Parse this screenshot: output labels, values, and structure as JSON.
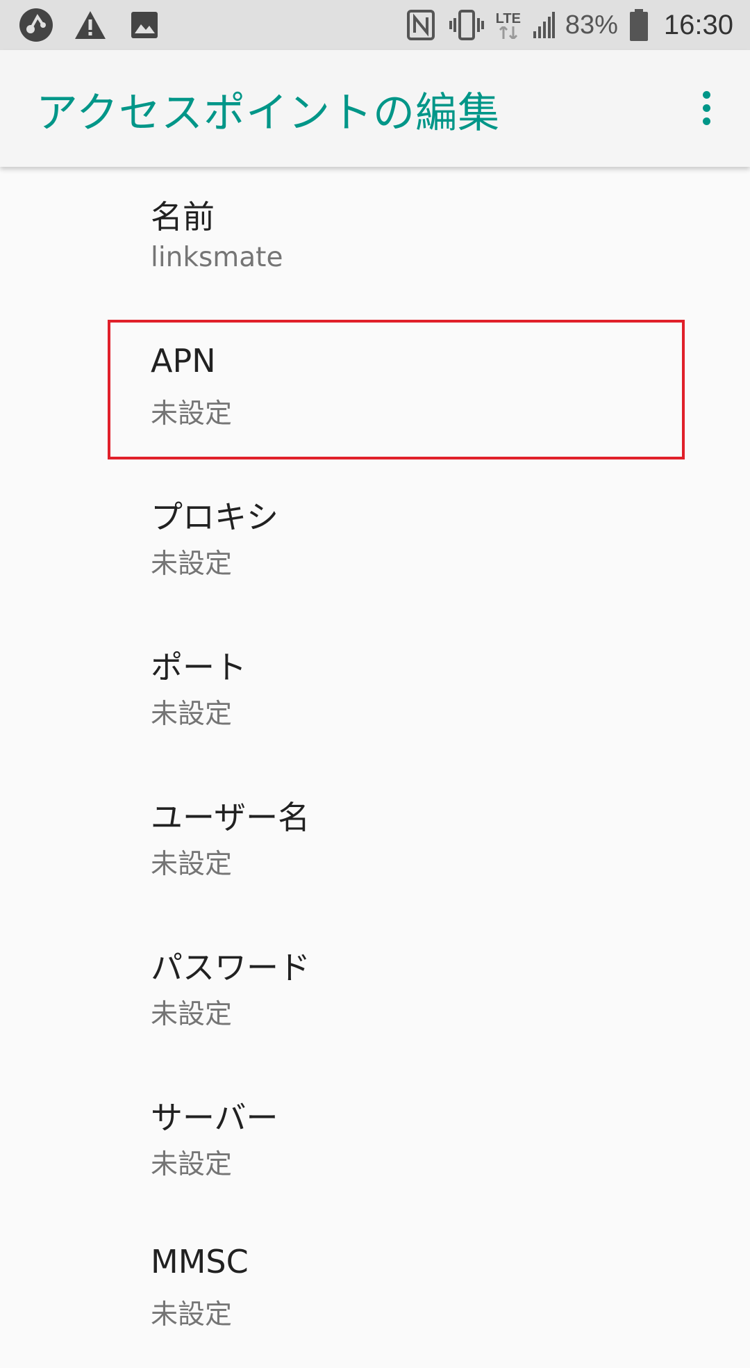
{
  "status_bar": {
    "battery_percent": "83%",
    "time": "16:30",
    "network_type": "LTE",
    "icons": [
      "app-notification-icon",
      "warning-icon",
      "image-icon",
      "nfc-icon",
      "vibrate-icon",
      "lte-icon",
      "signal-icon",
      "battery-icon"
    ]
  },
  "app_bar": {
    "title": "アクセスポイントの編集",
    "accent_color": "#009688"
  },
  "settings": [
    {
      "title": "名前",
      "value": "linksmate"
    },
    {
      "title": "APN",
      "value": "未設定"
    },
    {
      "title": "プロキシ",
      "value": "未設定"
    },
    {
      "title": "ポート",
      "value": "未設定"
    },
    {
      "title": "ユーザー名",
      "value": "未設定"
    },
    {
      "title": "パスワード",
      "value": "未設定"
    },
    {
      "title": "サーバー",
      "value": "未設定"
    },
    {
      "title": "MMSC",
      "value": "未設定"
    }
  ],
  "highlight_color": "#e0202a"
}
